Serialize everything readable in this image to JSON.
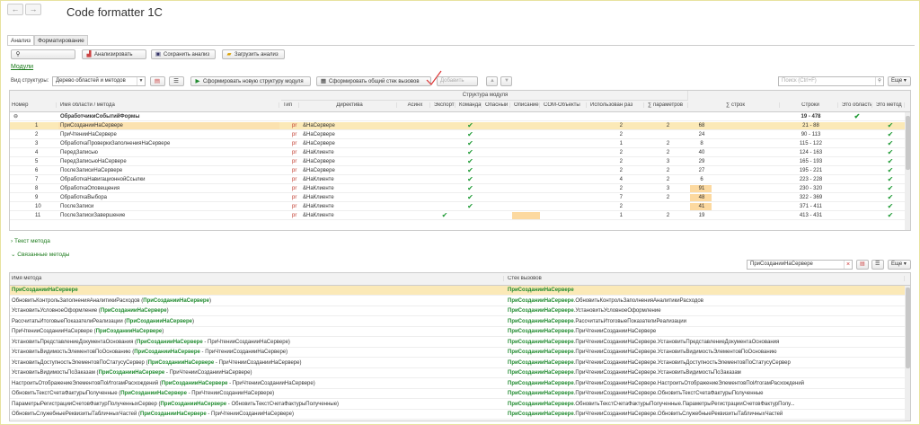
{
  "window": {
    "title": "Code formatter 1C",
    "back_icon": "←",
    "forward_icon": "→"
  },
  "tabs": [
    "Анализ",
    "Форматирование"
  ],
  "toolbar": {
    "analyze": "Анализировать",
    "save": "Сохранить анализ",
    "load": "Загрузить анализ"
  },
  "modules_link": "Модули",
  "structure": {
    "label": "Вид структуры:",
    "value": "Дерево областей и методов",
    "form_new": "Сформировать новую структуру модуля",
    "form_stack": "Сформировать общий стек вызовов",
    "add": "Добавить",
    "search_placeholder": "Поиск (Ctrl+F)",
    "more": "Еще"
  },
  "grid": {
    "group_header": "Структура модуля",
    "columns": [
      "Номер",
      "Имя области / метода",
      "Тип",
      "Директива",
      "Асинх",
      "Экспорт",
      "Команда",
      "Опасный",
      "Описание",
      "COM-Объекты",
      "Использован раз",
      "∑ параметров",
      "∑ строк",
      "Строки",
      "Это область",
      "Это метод"
    ],
    "group_row": {
      "name": "ОбработчикиСобытийФормы",
      "lines": "19 - 478"
    },
    "rows": [
      {
        "num": "1",
        "name": "ПриСозданииНаСервере",
        "type": "pr",
        "dir": "&НаСервере",
        "cmd": true,
        "used": "2",
        "params": "2",
        "lines": "68",
        "range": "21 - 88"
      },
      {
        "num": "2",
        "name": "ПриЧтенииНаСервере",
        "type": "pr",
        "dir": "&НаСервере",
        "cmd": true,
        "used": "2",
        "params": "",
        "lines": "24",
        "range": "90 - 113"
      },
      {
        "num": "3",
        "name": "ОбработкаПроверкиЗаполненияНаСервере",
        "type": "pr",
        "dir": "&НаСервере",
        "cmd": true,
        "used": "1",
        "params": "2",
        "lines": "8",
        "range": "115 - 122"
      },
      {
        "num": "4",
        "name": "ПередЗаписью",
        "type": "pr",
        "dir": "&НаКлиенте",
        "cmd": true,
        "used": "2",
        "params": "2",
        "lines": "40",
        "range": "124 - 163"
      },
      {
        "num": "5",
        "name": "ПередЗаписьюНаСервере",
        "type": "pr",
        "dir": "&НаСервере",
        "cmd": true,
        "used": "2",
        "params": "3",
        "lines": "29",
        "range": "165 - 193"
      },
      {
        "num": "6",
        "name": "ПослеЗаписиНаСервере",
        "type": "pr",
        "dir": "&НаСервере",
        "cmd": true,
        "used": "2",
        "params": "2",
        "lines": "27",
        "range": "195 - 221"
      },
      {
        "num": "7",
        "name": "ОбработкаНавигационнойСсылки",
        "type": "pr",
        "dir": "&НаКлиенте",
        "cmd": true,
        "used": "4",
        "params": "2",
        "lines": "6",
        "range": "223 - 228"
      },
      {
        "num": "8",
        "name": "ОбработкаОповещения",
        "type": "pr",
        "dir": "&НаКлиенте",
        "cmd": true,
        "used": "2",
        "params": "3",
        "lines": "91",
        "range": "230 - 320"
      },
      {
        "num": "9",
        "name": "ОбработкаВыбора",
        "type": "pr",
        "dir": "&НаКлиенте",
        "cmd": true,
        "used": "7",
        "params": "2",
        "lines": "48",
        "range": "322 - 369"
      },
      {
        "num": "10",
        "name": "ПослеЗаписи",
        "type": "pr",
        "dir": "&НаКлиенте",
        "cmd": true,
        "used": "2",
        "params": "",
        "lines": "41",
        "range": "371 - 411"
      },
      {
        "num": "11",
        "name": "ПослеЗаписиЗавершение",
        "type": "pr",
        "dir": "&НаКлиенте",
        "cmd": false,
        "used": "1",
        "params": "2",
        "lines": "19",
        "range": "413 - 431"
      }
    ]
  },
  "sections": {
    "method_text": "Текст метода",
    "related": "Связанные методы"
  },
  "related": {
    "search_value": "ПриСозданииНаСервере",
    "clear": "×",
    "more": "Еще",
    "col_method": "Имя метода",
    "col_stack": "Стек вызовов",
    "rows": [
      {
        "m_pre": "",
        "m_hl": "ПриСозданииНаСервере",
        "m_post": "",
        "s_hl": "ПриСозданииНаСервере",
        "s_post": ""
      },
      {
        "m_pre": "ОбновитьКонтрольЗаполненияАналитикиРасходов (",
        "m_hl": "ПриСозданииНаСервере",
        "m_post": ")",
        "s_hl": "ПриСозданииНаСервере",
        "s_post": ".ОбновитьКонтрольЗаполненияАналитикиРасходов"
      },
      {
        "m_pre": "УстановитьУсловноеОформление (",
        "m_hl": "ПриСозданииНаСервере",
        "m_post": ")",
        "s_hl": "ПриСозданииНаСервере",
        "s_post": ".УстановитьУсловноеОформление"
      },
      {
        "m_pre": "РассчитатьИтоговыеПоказателиРеализации (",
        "m_hl": "ПриСозданииНаСервере",
        "m_post": ")",
        "s_hl": "ПриСозданииНаСервере",
        "s_post": ".РассчитатьИтоговыеПоказателиРеализации"
      },
      {
        "m_pre": "ПриЧтенииСозданииНаСервере (",
        "m_hl": "ПриСозданииНаСервере",
        "m_post": ")",
        "s_hl": "ПриСозданииНаСервере",
        "s_post": ".ПриЧтенииСозданииНаСервере"
      },
      {
        "m_pre": "УстановитьПредставлениеДокументаОснования (",
        "m_hl": "ПриСозданииНаСервере",
        "m_post": " - ПриЧтенииСозданииНаСервере)",
        "s_hl": "ПриСозданииНаСервере",
        "s_post": ".ПриЧтенииСозданииНаСервере.УстановитьПредставлениеДокументаОснования"
      },
      {
        "m_pre": "УстановитьВидимостьЭлементовПоОснованию (",
        "m_hl": "ПриСозданииНаСервере",
        "m_post": " - ПриЧтенииСозданииНаСервере)",
        "s_hl": "ПриСозданииНаСервере",
        "s_post": ".ПриЧтенииСозданииНаСервере.УстановитьВидимостьЭлементовПоОснованию"
      },
      {
        "m_pre": "УстановитьДоступностьЭлементовПоСтатусуСервер (",
        "m_hl": "ПриСозданииНаСервере",
        "m_post": " - ПриЧтенииСозданииНаСервере)",
        "s_hl": "ПриСозданииНаСервере",
        "s_post": ".ПриЧтенииСозданииНаСервере.УстановитьДоступностьЭлементовПоСтатусуСервер"
      },
      {
        "m_pre": "УстановитьВидимостьПоЗаказам (",
        "m_hl": "ПриСозданииНаСервере",
        "m_post": " - ПриЧтенииСозданииНаСервере)",
        "s_hl": "ПриСозданииНаСервере",
        "s_post": ".ПриЧтенииСозданииНаСервере.УстановитьВидимостьПоЗаказам"
      },
      {
        "m_pre": "НастроитьОтображениеЭлементовПоИтогамРасхождений (",
        "m_hl": "ПриСозданииНаСервере",
        "m_post": " - ПриЧтенииСозданииНаСервере)",
        "s_hl": "ПриСозданииНаСервере",
        "s_post": ".ПриЧтенииСозданииНаСервере.НастроитьОтображениеЭлементовПоИтогамРасхождений"
      },
      {
        "m_pre": "ОбновитьТекстСчетаФактурыПолученные (",
        "m_hl": "ПриСозданииНаСервере",
        "m_post": " - ПриЧтенииСозданииНаСервере)",
        "s_hl": "ПриСозданииНаСервере",
        "s_post": ".ПриЧтенииСозданииНаСервере.ОбновитьТекстСчетаФактурыПолученные"
      },
      {
        "m_pre": "ПараметрыРегистрацииСчетовФактурПолученныхСервер (",
        "m_hl": "ПриСозданииНаСервере",
        "m_post": " - ОбновитьТекстСчетаФактурыПолученные)",
        "s_hl": "ПриСозданииНаСервере",
        "s_post": ".ОбновитьТекстСчетаФактурыПолученные.ПараметрыРегистрацииСчетовФактурПолу..."
      },
      {
        "m_pre": "ОбновитьСлужебныеРеквизитыТабличныхЧастей (",
        "m_hl": "ПриСозданииНаСервере",
        "m_post": " - ПриЧтенииСозданииНаСервере)",
        "s_hl": "ПриСозданииНаСервере",
        "s_post": ".ПриЧтенииСозданииНаСервере.ОбновитьСлужебныеРеквизитыТабличныхЧастей"
      }
    ]
  },
  "colors": {
    "accent_green": "#1f8a2e",
    "selection": "#fbe9b7",
    "highlight": "#fcd9a0",
    "type_red": "#c0392b"
  }
}
